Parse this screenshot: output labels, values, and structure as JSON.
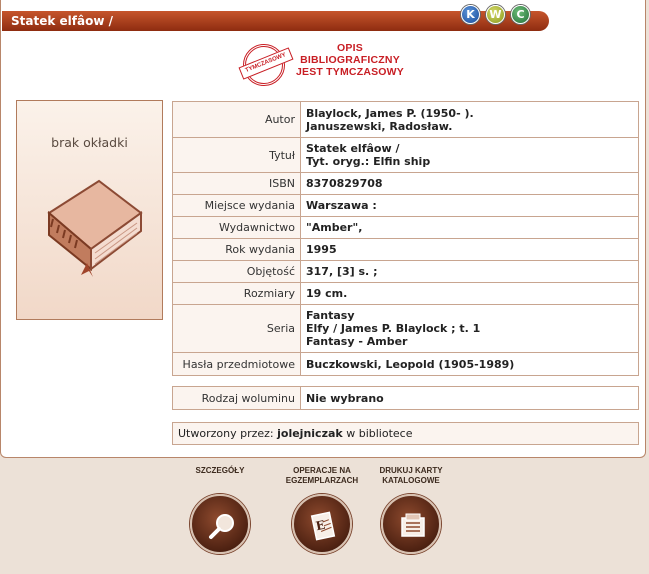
{
  "header": {
    "title": "Statek elfâow /",
    "formats": [
      {
        "letter": "K",
        "color": "#1a4c9a"
      },
      {
        "letter": "W",
        "color": "#8b9a1c"
      },
      {
        "letter": "C",
        "color": "#23703a"
      }
    ]
  },
  "stamp": {
    "band": "TYMCZASOWY",
    "line1": "OPIS",
    "line2": "BIBLIOGRAFICZNY",
    "line3": "JEST TYMCZASOWY"
  },
  "cover": {
    "text": "brak okładki",
    "icon": "book-icon"
  },
  "record": {
    "rows": [
      {
        "label": "Autor",
        "values": [
          "Blaylock, James P. (1950- ).",
          "Januszewski, Radosław."
        ]
      },
      {
        "label": "Tytuł",
        "values": [
          "Statek elfâow /",
          "Tyt. oryg.: Elfin ship"
        ]
      },
      {
        "label": "ISBN",
        "values": [
          "8370829708"
        ]
      },
      {
        "label": "Miejsce wydania",
        "values": [
          "Warszawa :"
        ]
      },
      {
        "label": "Wydawnictwo",
        "values": [
          "\"Amber\","
        ]
      },
      {
        "label": "Rok wydania",
        "values": [
          "1995"
        ]
      },
      {
        "label": "Objętość",
        "values": [
          "317, [3] s. ;"
        ]
      },
      {
        "label": "Rozmiary",
        "values": [
          "19 cm."
        ]
      },
      {
        "label": "Seria",
        "values": [
          "Fantasy",
          "Elfy / James P. Blaylock ; t. 1",
          "Fantasy - Amber"
        ]
      },
      {
        "label": "Hasła przedmiotowe",
        "values": [
          "Buczkowski, Leopold (1905-1989)"
        ]
      }
    ]
  },
  "volume": {
    "label": "Rodzaj woluminu",
    "value": "Nie wybrano"
  },
  "created": {
    "prefix": "Utworzony przez:",
    "user": "jolejniczak",
    "suffix": "w bibliotece"
  },
  "actions": [
    {
      "label": "SZCZEGÓŁY",
      "icon": "magnifier-icon"
    },
    {
      "label": "OPERACJE NA EGZEMPLARZACH",
      "icon": "document-e-icon"
    },
    {
      "label": "DRUKUJ KARTY KATALOGOWE",
      "icon": "catalog-card-icon"
    }
  ]
}
